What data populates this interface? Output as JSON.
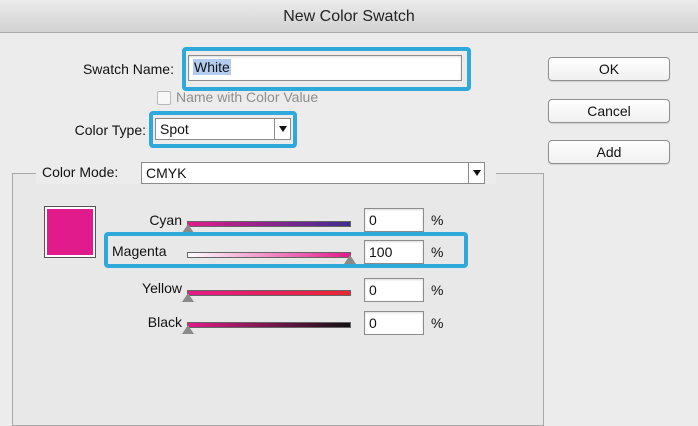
{
  "window": {
    "title": "New Color Swatch"
  },
  "swatch_name": {
    "label": "Swatch Name:",
    "value": "White"
  },
  "name_with_value": {
    "label": "Name with Color Value",
    "checked": false,
    "enabled": false
  },
  "color_type": {
    "label": "Color Type:",
    "value": "Spot"
  },
  "color_mode": {
    "label": "Color Mode:",
    "value": "CMYK"
  },
  "buttons": {
    "ok": "OK",
    "cancel": "Cancel",
    "add": "Add"
  },
  "preview_color": "#e11b8b",
  "channels": [
    {
      "name": "Cyan",
      "value": "0",
      "unit": "%"
    },
    {
      "name": "Magenta",
      "value": "100",
      "unit": "%"
    },
    {
      "name": "Yellow",
      "value": "0",
      "unit": "%"
    },
    {
      "name": "Black",
      "value": "0",
      "unit": "%"
    }
  ],
  "highlight_color": "#2fa8dc"
}
